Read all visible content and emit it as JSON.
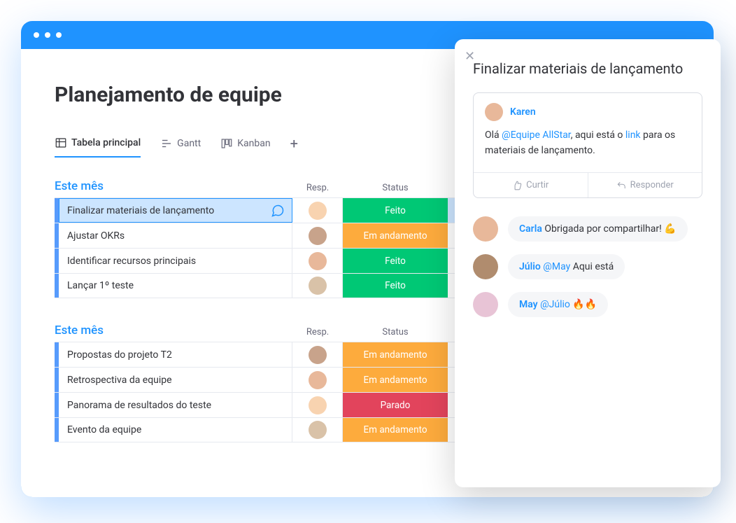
{
  "page_title": "Planejamento de equipe",
  "views": {
    "main": "Tabela principal",
    "gantt": "Gantt",
    "kanban": "Kanban"
  },
  "columns": {
    "resp": "Resp.",
    "status": "Status"
  },
  "status_colors": {
    "done": "#00c875",
    "working": "#fdab3d",
    "stuck": "#e2445c"
  },
  "avatar_colors": [
    "#f8d3b0",
    "#c8a38b",
    "#e8b89a",
    "#d9c2a8",
    "#b08c6e",
    "#e8c4d6"
  ],
  "groups": [
    {
      "title": "Este mês",
      "rows": [
        {
          "name": "Finalizar materiais de lançamento",
          "avatar": 0,
          "status_key": "done",
          "status": "Feito",
          "selected": true,
          "chat": true
        },
        {
          "name": "Ajustar OKRs",
          "avatar": 1,
          "status_key": "working",
          "status": "Em andamento"
        },
        {
          "name": "Identificar recursos principais",
          "avatar": 2,
          "status_key": "done",
          "status": "Feito"
        },
        {
          "name": "Lançar 1º teste",
          "avatar": 3,
          "status_key": "done",
          "status": "Feito"
        }
      ]
    },
    {
      "title": "Este mês",
      "rows": [
        {
          "name": "Propostas do projeto T2",
          "avatar": 1,
          "status_key": "working",
          "status": "Em andamento"
        },
        {
          "name": "Retrospectiva da equipe",
          "avatar": 2,
          "status_key": "working",
          "status": "Em andamento"
        },
        {
          "name": "Panorama de resultados do teste",
          "avatar": 0,
          "status_key": "stuck",
          "status": "Parado"
        },
        {
          "name": "Evento da equipe",
          "avatar": 3,
          "status_key": "working",
          "status": "Em andamento"
        }
      ]
    }
  ],
  "panel": {
    "title": "Finalizar materiais de lançamento",
    "author": "Karen",
    "body_pre": "Olá ",
    "body_mention": "@Equipe AllStar",
    "body_mid": ", aqui está o  ",
    "body_link": "link",
    "body_post": " para os materiais de lançamento.",
    "like": "Curtir",
    "reply": "Responder",
    "replies": [
      {
        "user": "Carla",
        "text": " Obrigada por compartilhar! 💪",
        "avatar": 2
      },
      {
        "user": "Júlio",
        "mention": "@May",
        "text": " Aqui está",
        "avatar": 4
      },
      {
        "user": "May",
        "mention": "@Júlio",
        "text": " 🔥🔥",
        "avatar": 5
      }
    ]
  }
}
